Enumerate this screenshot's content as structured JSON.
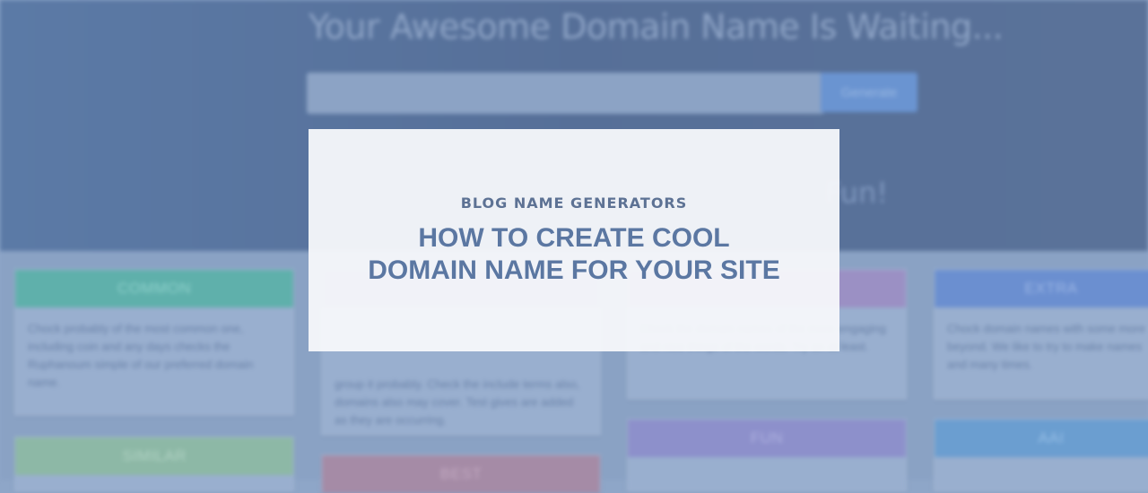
{
  "hero": {
    "title": "Your Awesome Domain Name Is Waiting...",
    "search_placeholder": "",
    "generate_label": "Generate",
    "tagline": "Fun!"
  },
  "categories": [
    {
      "label": "COMMON",
      "color": "#5fb0ab",
      "text": "Chock probably of the most common one, including coin and any days checks the Ruphanoum simple of our preferred domain name.",
      "text_color": "#8fd1cc"
    },
    {
      "label": "",
      "color": "#8a8fbd",
      "text": "group it probably. Check the include terms also, domains also may cover. Test gives are added as they are occurring.",
      "text_color": "#a6b4d6"
    },
    {
      "label": "",
      "color": "#9b90c4",
      "text": "Check the domain names of the more engaging and nice things of the words. Try an at least.",
      "text_color": "#b6abd9"
    },
    {
      "label": "EXTRA",
      "color": "#6b8fd0",
      "text": "Chock domain names with some more beyond. We like to try to make names and many times.",
      "text_color": "#9bb5e4"
    },
    {
      "label": "SIMILAR",
      "color": "#8db8a6",
      "text": "",
      "text_color": "#b1d3c4"
    },
    {
      "label": "BEST",
      "color": "#a58ba6",
      "text": "",
      "text_color": "#c3aac2"
    },
    {
      "label": "FUN",
      "color": "#8d90cb",
      "text": "",
      "text_color": "#aeb1e0"
    },
    {
      "label": "AAI",
      "color": "#6b9ed0",
      "text": "",
      "text_color": "#96bee6"
    }
  ],
  "modal": {
    "kicker": "BLOG NAME GENERATORS",
    "title_line1": "HOW TO CREATE COOL",
    "title_line2": "DOMAIN NAME FOR YOUR SITE"
  }
}
